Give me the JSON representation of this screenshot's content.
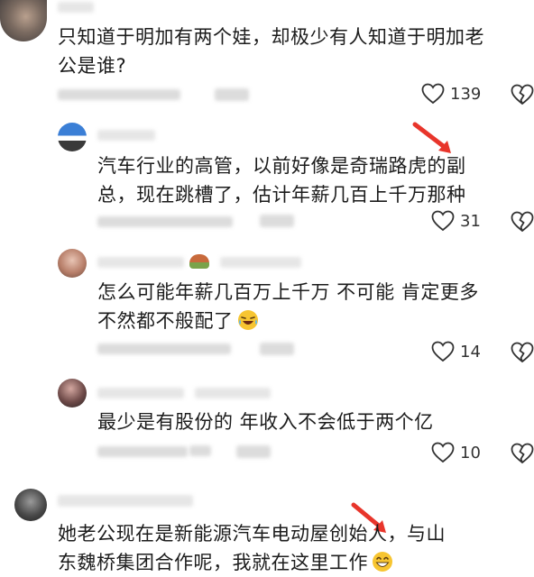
{
  "comments": [
    {
      "text_line1": "只知道于明加有两个娃，却极少有人知道于明加老",
      "text_line2": "公是谁?",
      "likes": "139"
    },
    {
      "text_line1": "汽车行业的高管，以前好像是奇瑞路虎的副",
      "text_line2": "总，现在跳槽了，估计年薪几百上千万那种",
      "likes": "31"
    },
    {
      "text_line1": "怎么可能年薪几百万上千万 不可能 肯定更多",
      "text_line2": "不然都不般配了",
      "likes": "14"
    },
    {
      "text_line1": "最少是有股份的 年收入不会低于两个亿",
      "likes": "10"
    },
    {
      "text_line1": "她老公现在是新能源汽车电动屋创始人，与山",
      "text_line2": "东魏桥集团合作呢，我就在这里工作"
    }
  ],
  "icons": {
    "like": "heart-outline-icon",
    "dislike": "broken-heart-icon",
    "annotation": "red-arrow-icon"
  },
  "colors": {
    "accent_arrow": "#e8352b",
    "text": "#1c1c1c",
    "meta": "#b8b8b8"
  }
}
